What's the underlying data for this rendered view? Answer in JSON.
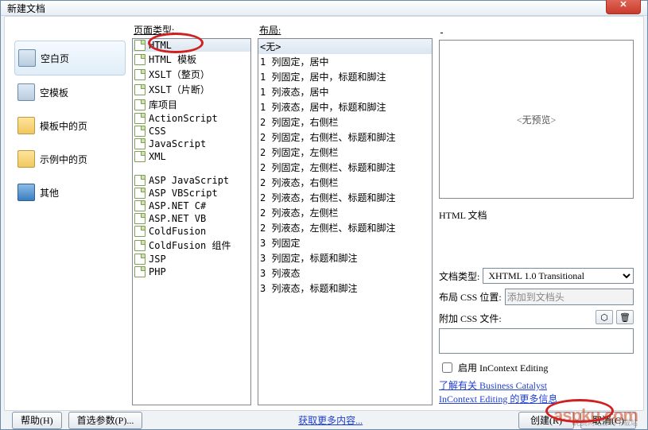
{
  "window": {
    "title": "新建文档",
    "close": "✕"
  },
  "sidebar": {
    "items": [
      {
        "label": "空白页"
      },
      {
        "label": "空模板"
      },
      {
        "label": "模板中的页"
      },
      {
        "label": "示例中的页"
      },
      {
        "label": "其他"
      }
    ]
  },
  "pagetype": {
    "header": "页面类型:",
    "groups": [
      [
        "HTML",
        "HTML 模板",
        "XSLT（整页）",
        "XSLT（片断）",
        "库项目",
        "ActionScript",
        "CSS",
        "JavaScript",
        "XML"
      ],
      [
        "ASP JavaScript",
        "ASP VBScript",
        "ASP.NET C#",
        "ASP.NET VB",
        "ColdFusion",
        "ColdFusion 组件",
        "JSP",
        "PHP"
      ]
    ],
    "selected": "HTML"
  },
  "layout": {
    "header": "布局:",
    "items": [
      "<无>",
      "1 列固定，居中",
      "1 列固定，居中，标题和脚注",
      "1 列液态，居中",
      "1 列液态，居中，标题和脚注",
      "2 列固定，右侧栏",
      "2 列固定，右侧栏、标题和脚注",
      "2 列固定，左侧栏",
      "2 列固定，左侧栏、标题和脚注",
      "2 列液态，右侧栏",
      "2 列液态，右侧栏、标题和脚注",
      "2 列液态，左侧栏",
      "2 列液态，左侧栏、标题和脚注",
      "3 列固定",
      "3 列固定，标题和脚注",
      "3 列液态",
      "3 列液态，标题和脚注"
    ],
    "selected": "<无>"
  },
  "right": {
    "preview_placeholder": "<无预览>",
    "desc": "HTML 文档",
    "doctype_label": "文档类型:",
    "doctype_options": [
      "XHTML 1.0 Transitional"
    ],
    "csspos_label": "布局 CSS 位置:",
    "csspos_value": "添加到文档头",
    "attach_label": "附加 CSS 文件:",
    "link_icon": "⬡",
    "trash_icon": "🗑",
    "enable_incontext": "启用 InContext Editing",
    "learn_link": "了解有关 Business Catalyst InContext Editing 的更多信息"
  },
  "footer": {
    "help": "帮助(H)",
    "prefs": "首选参数(P)...",
    "more_link": "获取更多内容...",
    "create": "创建(R)",
    "cancel": "取消(C)"
  },
  "watermark": "aspku.com",
  "watermark_sub": "免费网站源码下载站"
}
